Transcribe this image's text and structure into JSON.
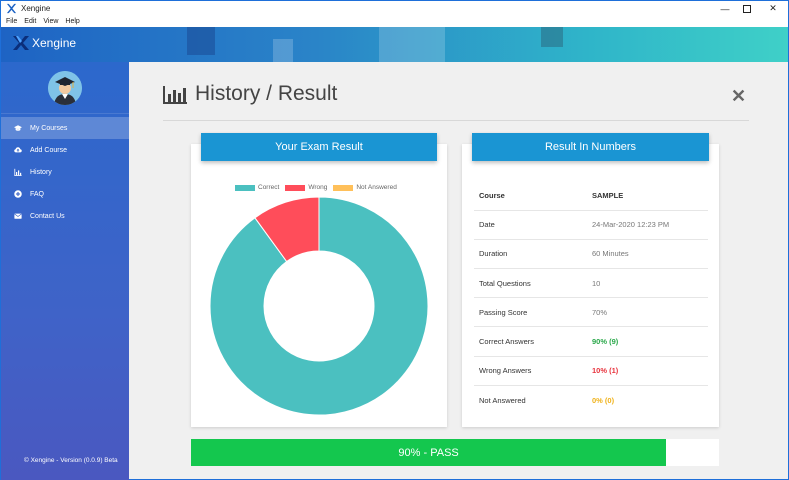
{
  "window": {
    "title": "Xengine",
    "minimize_icon": "minimize-icon",
    "maximize_icon": "maximize-icon",
    "close_icon": "close-icon"
  },
  "menu": [
    "File",
    "Edit",
    "View",
    "Help"
  ],
  "header": {
    "brand": "Xengine"
  },
  "sidebar": {
    "items": [
      {
        "label": "My Courses",
        "icon": "graduation-cap-icon",
        "active": true
      },
      {
        "label": "Add Course",
        "icon": "cloud-upload-icon",
        "active": false
      },
      {
        "label": "History",
        "icon": "bar-chart-icon",
        "active": false
      },
      {
        "label": "FAQ",
        "icon": "plus-circle-icon",
        "active": false
      },
      {
        "label": "Contact Us",
        "icon": "envelope-icon",
        "active": false
      }
    ],
    "footer": "© Xengine - Version (0.0.9) Beta"
  },
  "page": {
    "title": "History / Result"
  },
  "exam_card": {
    "title": "Your Exam Result"
  },
  "chart_data": {
    "type": "pie",
    "subtype": "doughnut",
    "legend_placement": "top",
    "categories": [
      "Correct",
      "Wrong",
      "Not Answered"
    ],
    "values": [
      9,
      1,
      0
    ],
    "colors": [
      "#4bc0c0",
      "#ff4d5a",
      "#ffc05a"
    ]
  },
  "numbers_card": {
    "title": "Result In Numbers",
    "rows": [
      {
        "label": "Course",
        "value": "SAMPLE",
        "style": "header"
      },
      {
        "label": "Date",
        "value": "24-Mar-2020 12:23 PM",
        "style": "plain"
      },
      {
        "label": "Duration",
        "value": "60 Minutes",
        "style": "plain"
      },
      {
        "label": "Total Questions",
        "value": "10",
        "style": "plain"
      },
      {
        "label": "Passing Score",
        "value": "70%",
        "style": "plain"
      },
      {
        "label": "Correct Answers",
        "value": "90% (9)",
        "style": "correct"
      },
      {
        "label": "Wrong Answers",
        "value": "10% (1)",
        "style": "wrong"
      },
      {
        "label": "Not Answered",
        "value": "0% (0)",
        "style": "unanswered"
      }
    ]
  },
  "progress": {
    "label": "90% - PASS",
    "value": 0.9
  },
  "colors": {
    "correct": "#2aa84a",
    "wrong": "#e8343e",
    "unanswered": "#f0b21a",
    "pass": "#14c74e",
    "card_header": "#1a95d3"
  }
}
